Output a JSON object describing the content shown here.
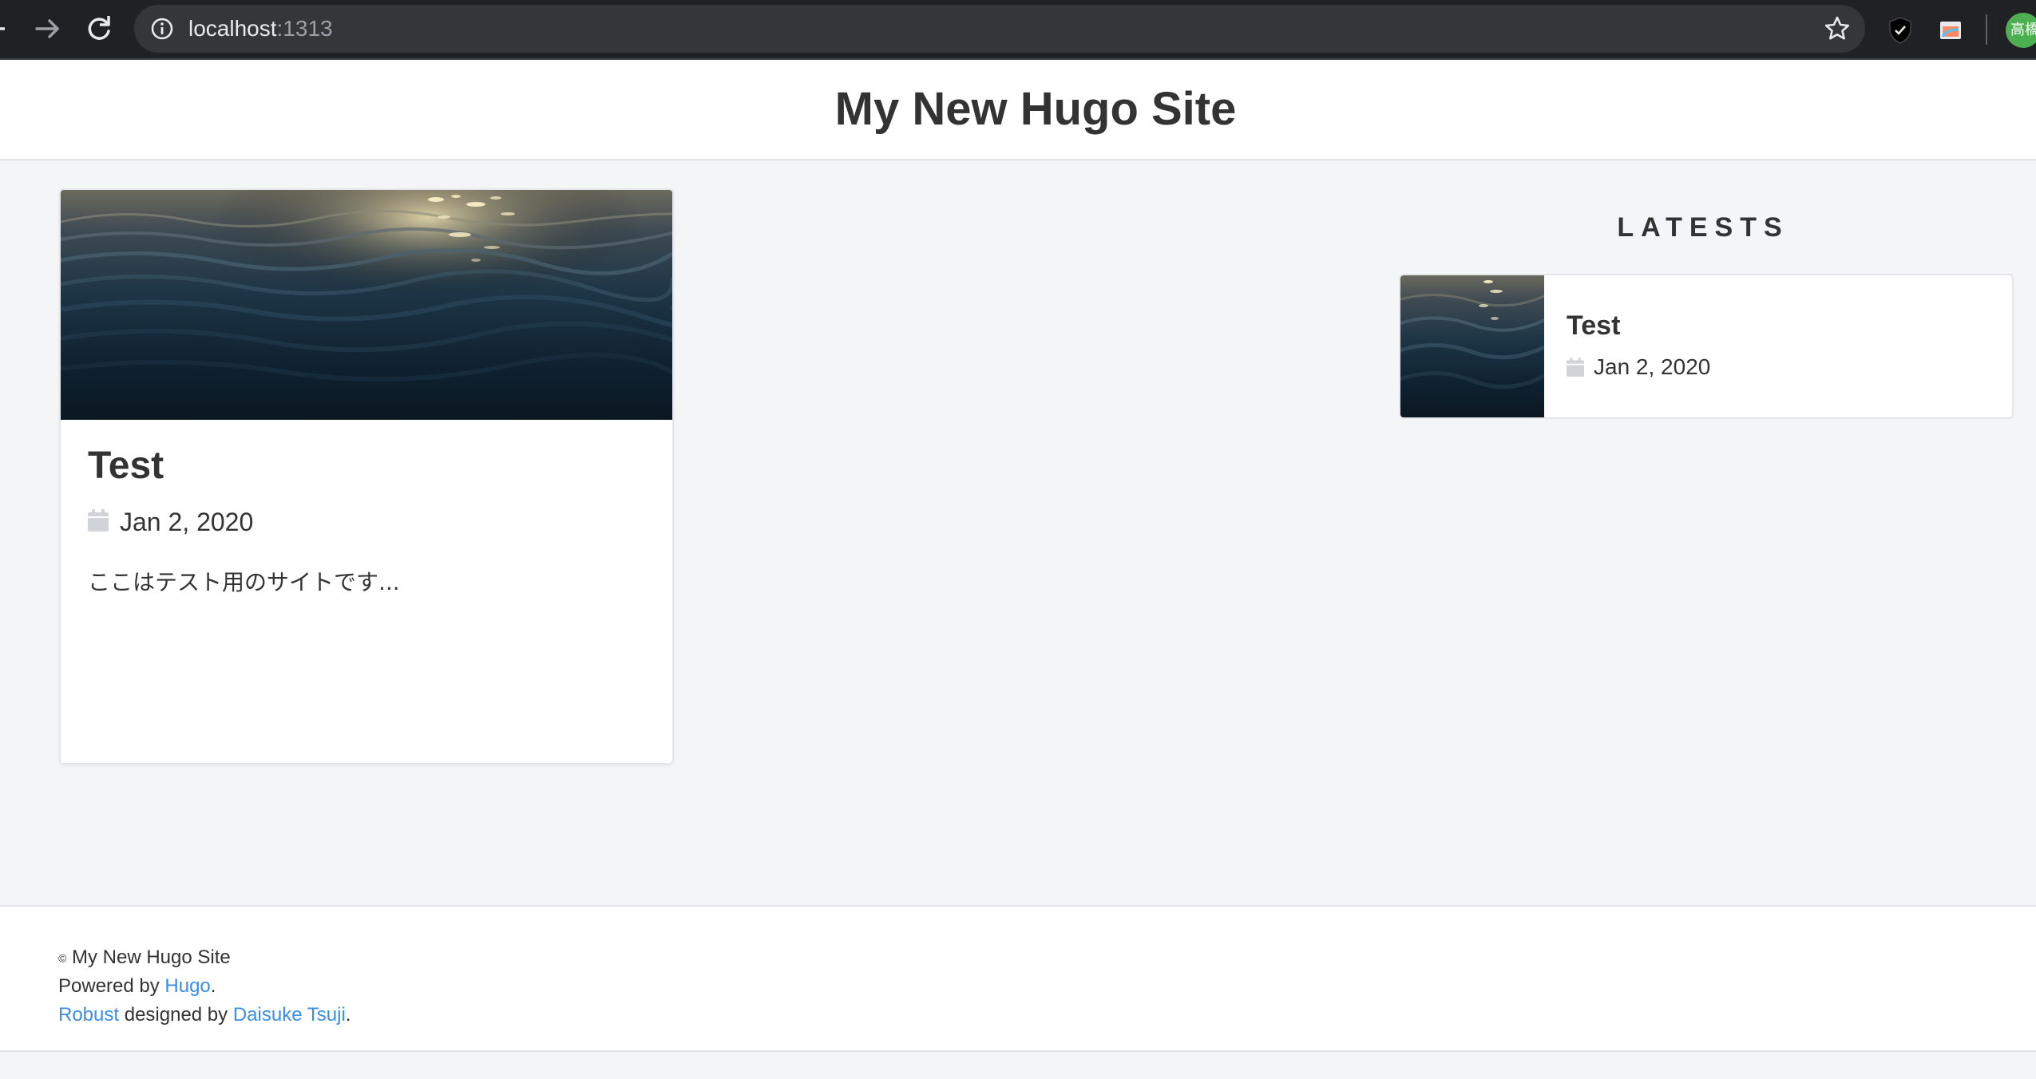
{
  "browser": {
    "url_host": "localhost",
    "url_port": ":1313",
    "avatar_text": "高橋"
  },
  "site": {
    "title": "My New Hugo Site"
  },
  "post": {
    "title": "Test",
    "date": "Jan 2, 2020",
    "summary": "ここはテスト用のサイトです..."
  },
  "sidebar": {
    "heading": "LATESTS",
    "items": [
      {
        "title": "Test",
        "date": "Jan 2, 2020"
      }
    ]
  },
  "footer": {
    "copyright_symbol": "©",
    "copyright_text": "My New Hugo Site",
    "powered_prefix": "Powered by ",
    "powered_link": "Hugo",
    "period": ".",
    "theme_link": "Robust",
    "designed_by": " designed by ",
    "designer_link": "Daisuke Tsuji"
  },
  "colors": {
    "link": "#3a8ee6",
    "page_bg": "#f4f5f7",
    "text": "#333333"
  }
}
